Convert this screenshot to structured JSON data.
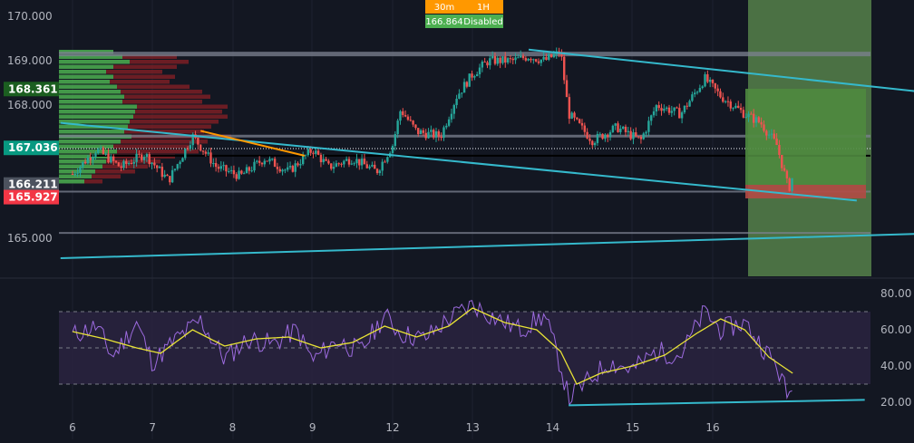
{
  "colors": {
    "background": "#131722",
    "grid": "#1f2433",
    "up": "#26a69a",
    "down": "#ef5350",
    "trendline": "#35b9cc",
    "short_trend": "#ff9800",
    "rsi_line": "#9c6ade",
    "rsi_ma": "#e8e336",
    "rsi_band": "#2a2340",
    "profile_up": "#4caf50",
    "profile_down": "#7b1f24",
    "position_target": "#4f8a3f",
    "position_stop": "#b34a45",
    "zone": "#5b8a4e",
    "level_gray": "#7d8291",
    "badge_green_dark": "#1b5e20",
    "badge_teal": "#089981",
    "badge_gray": "#4c525e",
    "badge_red": "#f23645",
    "badge_orange": "#ff9800",
    "badge_green": "#4caf50"
  },
  "top_badges": {
    "tf_left": "30m",
    "tf_right": "1H",
    "value": "166.864",
    "status": "Disabled"
  },
  "price_badges": [
    {
      "label": "168.361",
      "value": 168.361,
      "color": "#1b5e20"
    },
    {
      "label": "167.036",
      "value": 167.036,
      "color": "#089981"
    },
    {
      "label": "166.211",
      "value": 166.211,
      "color": "#4c525e"
    },
    {
      "label": "165.927",
      "value": 165.927,
      "color": "#f23645"
    }
  ],
  "chart_data": [
    {
      "type": "line",
      "panel": "price",
      "y_ticks": [
        "170.000",
        "169.000",
        "168.000",
        "165.000"
      ],
      "y_tick_values": [
        170,
        169,
        168,
        165
      ],
      "ylim": [
        164.0,
        170.35
      ],
      "x_ticks": [
        "6",
        "7",
        "8",
        "9",
        "12",
        "13",
        "14",
        "15",
        "16"
      ],
      "close_series": [
        {
          "x": 0,
          "y": 166.45
        },
        {
          "x": 0.3,
          "y": 167.0
        },
        {
          "x": 0.6,
          "y": 166.6
        },
        {
          "x": 0.9,
          "y": 166.9
        },
        {
          "x": 1.2,
          "y": 166.3
        },
        {
          "x": 1.5,
          "y": 167.3
        },
        {
          "x": 1.8,
          "y": 166.6
        },
        {
          "x": 2.1,
          "y": 166.4
        },
        {
          "x": 2.4,
          "y": 166.8
        },
        {
          "x": 2.7,
          "y": 166.5
        },
        {
          "x": 3.0,
          "y": 167.0
        },
        {
          "x": 3.2,
          "y": 166.6
        },
        {
          "x": 3.5,
          "y": 166.8
        },
        {
          "x": 3.8,
          "y": 166.5
        },
        {
          "x": 4.0,
          "y": 167.1
        },
        {
          "x": 4.1,
          "y": 167.9
        },
        {
          "x": 4.3,
          "y": 167.4
        },
        {
          "x": 4.6,
          "y": 167.3
        },
        {
          "x": 4.8,
          "y": 168.2
        },
        {
          "x": 5.0,
          "y": 168.7
        },
        {
          "x": 5.2,
          "y": 169.0
        },
        {
          "x": 5.5,
          "y": 169.0
        },
        {
          "x": 5.7,
          "y": 169.1
        },
        {
          "x": 5.9,
          "y": 169.0
        },
        {
          "x": 6.1,
          "y": 169.2
        },
        {
          "x": 6.2,
          "y": 167.8
        },
        {
          "x": 6.5,
          "y": 167.2
        },
        {
          "x": 6.8,
          "y": 167.5
        },
        {
          "x": 7.1,
          "y": 167.2
        },
        {
          "x": 7.3,
          "y": 168.0
        },
        {
          "x": 7.6,
          "y": 167.8
        },
        {
          "x": 7.9,
          "y": 168.6
        },
        {
          "x": 8.1,
          "y": 168.2
        },
        {
          "x": 8.4,
          "y": 167.8
        },
        {
          "x": 8.6,
          "y": 167.6
        },
        {
          "x": 8.8,
          "y": 167.1
        },
        {
          "x": 8.95,
          "y": 166.1
        },
        {
          "x": 9.0,
          "y": 166.4
        }
      ],
      "trendlines": [
        {
          "name": "channel-top",
          "from": {
            "x": 5.7,
            "y": 169.25
          },
          "to": {
            "x": 10.6,
            "y": 168.3
          }
        },
        {
          "name": "wedge-lower",
          "from": {
            "x": -0.15,
            "y": 167.6
          },
          "to": {
            "x": 9.8,
            "y": 165.85
          }
        },
        {
          "name": "long-support",
          "from": {
            "x": -0.15,
            "y": 164.55
          },
          "to": {
            "x": 10.6,
            "y": 165.1
          }
        },
        {
          "name": "short-orange",
          "from": {
            "x": 1.6,
            "y": 167.42
          },
          "to": {
            "x": 2.9,
            "y": 166.86
          }
        }
      ],
      "horizontal_levels": [
        169.15,
        167.3,
        167.02,
        166.05,
        165.12
      ]
    },
    {
      "type": "line",
      "panel": "rsi",
      "y_ticks": [
        "80.00",
        "60.00",
        "40.00",
        "20.00"
      ],
      "y_tick_values": [
        80,
        60,
        40,
        20
      ],
      "ylim": [
        16,
        84
      ],
      "band": [
        30,
        70
      ],
      "x_ticks": [
        "6",
        "7",
        "8",
        "9",
        "12",
        "13",
        "14",
        "15",
        "16"
      ],
      "rsi": [
        {
          "x": 0,
          "y": 57
        },
        {
          "x": 0.3,
          "y": 62
        },
        {
          "x": 0.5,
          "y": 45
        },
        {
          "x": 0.8,
          "y": 64
        },
        {
          "x": 1.0,
          "y": 42
        },
        {
          "x": 1.3,
          "y": 55
        },
        {
          "x": 1.6,
          "y": 65
        },
        {
          "x": 1.9,
          "y": 44
        },
        {
          "x": 2.2,
          "y": 55
        },
        {
          "x": 2.5,
          "y": 52
        },
        {
          "x": 2.8,
          "y": 60
        },
        {
          "x": 3.0,
          "y": 43
        },
        {
          "x": 3.3,
          "y": 54
        },
        {
          "x": 3.6,
          "y": 48
        },
        {
          "x": 3.9,
          "y": 68
        },
        {
          "x": 4.1,
          "y": 58
        },
        {
          "x": 4.4,
          "y": 55
        },
        {
          "x": 4.7,
          "y": 66
        },
        {
          "x": 5.0,
          "y": 74
        },
        {
          "x": 5.3,
          "y": 66
        },
        {
          "x": 5.6,
          "y": 60
        },
        {
          "x": 5.9,
          "y": 68
        },
        {
          "x": 6.1,
          "y": 40
        },
        {
          "x": 6.2,
          "y": 22
        },
        {
          "x": 6.4,
          "y": 30
        },
        {
          "x": 6.7,
          "y": 42
        },
        {
          "x": 7.0,
          "y": 38
        },
        {
          "x": 7.3,
          "y": 48
        },
        {
          "x": 7.6,
          "y": 46
        },
        {
          "x": 7.9,
          "y": 70
        },
        {
          "x": 8.1,
          "y": 60
        },
        {
          "x": 8.4,
          "y": 64
        },
        {
          "x": 8.6,
          "y": 52
        },
        {
          "x": 8.8,
          "y": 40
        },
        {
          "x": 8.95,
          "y": 22
        },
        {
          "x": 9.0,
          "y": 34
        }
      ],
      "rsi_ma": [
        {
          "x": 0,
          "y": 59
        },
        {
          "x": 0.4,
          "y": 55
        },
        {
          "x": 0.8,
          "y": 50
        },
        {
          "x": 1.1,
          "y": 47
        },
        {
          "x": 1.5,
          "y": 60
        },
        {
          "x": 1.9,
          "y": 51
        },
        {
          "x": 2.3,
          "y": 55
        },
        {
          "x": 2.7,
          "y": 56
        },
        {
          "x": 3.1,
          "y": 50
        },
        {
          "x": 3.5,
          "y": 53
        },
        {
          "x": 3.9,
          "y": 62
        },
        {
          "x": 4.3,
          "y": 56
        },
        {
          "x": 4.7,
          "y": 62
        },
        {
          "x": 5.0,
          "y": 72
        },
        {
          "x": 5.4,
          "y": 64
        },
        {
          "x": 5.8,
          "y": 60
        },
        {
          "x": 6.1,
          "y": 48
        },
        {
          "x": 6.3,
          "y": 30
        },
        {
          "x": 6.6,
          "y": 36
        },
        {
          "x": 7.0,
          "y": 40
        },
        {
          "x": 7.4,
          "y": 46
        },
        {
          "x": 7.8,
          "y": 58
        },
        {
          "x": 8.1,
          "y": 66
        },
        {
          "x": 8.4,
          "y": 60
        },
        {
          "x": 8.7,
          "y": 45
        },
        {
          "x": 9.0,
          "y": 36
        }
      ],
      "trendlines": [
        {
          "name": "rsi-support",
          "from": {
            "x": 6.2,
            "y": 18.3
          },
          "to": {
            "x": 9.9,
            "y": 21.3
          }
        }
      ]
    }
  ]
}
